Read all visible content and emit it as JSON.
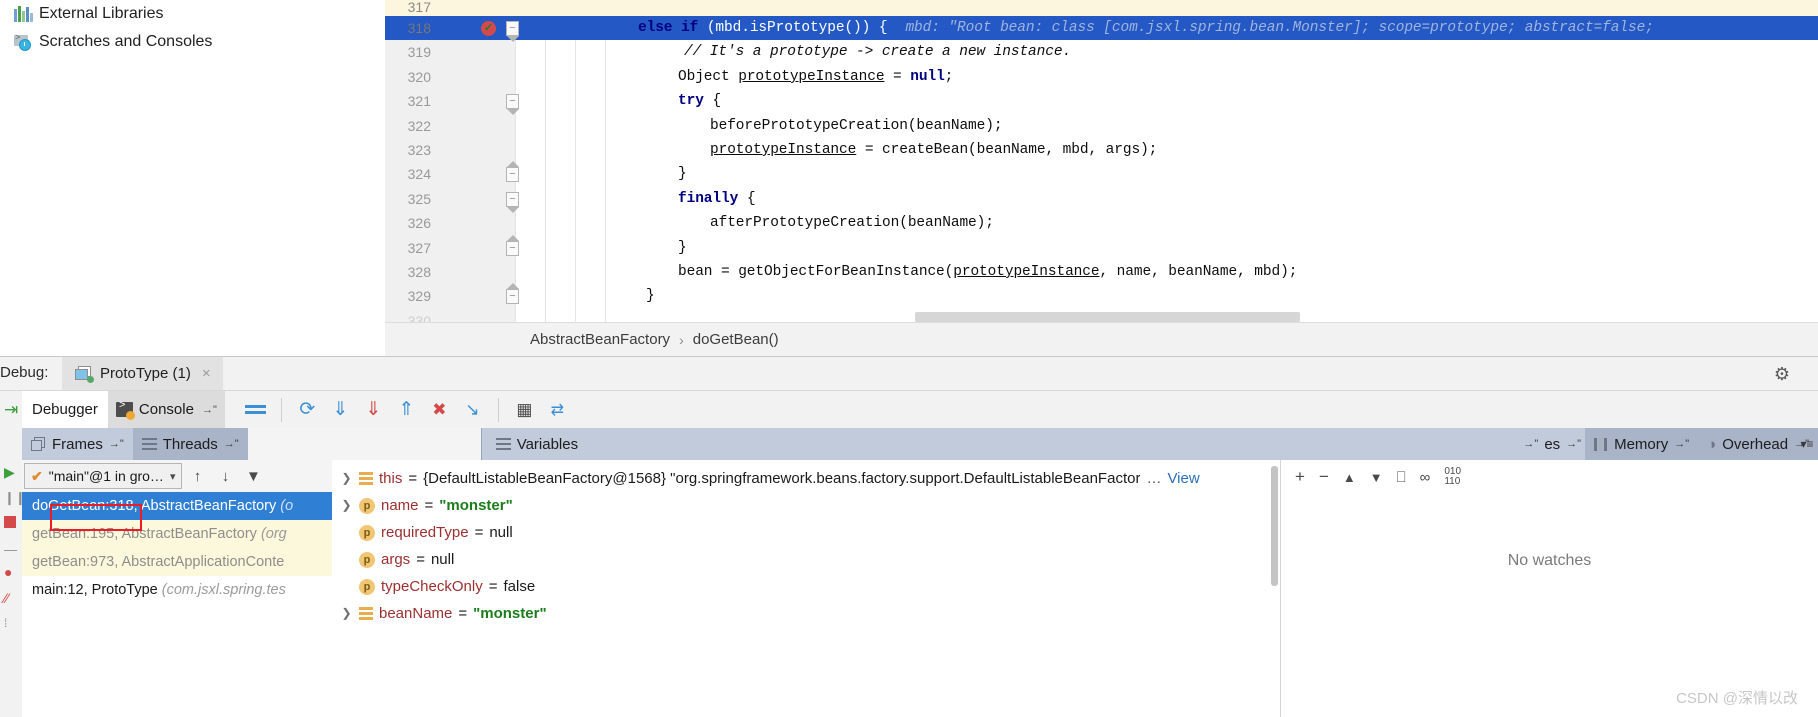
{
  "project_tree": {
    "items": [
      {
        "label": "External Libraries",
        "icon": "libraries-icon"
      },
      {
        "label": "Scratches and Consoles",
        "icon": "scratches-icon"
      }
    ]
  },
  "editor": {
    "lines": [
      {
        "num": "317",
        "code": "",
        "state": "above"
      },
      {
        "num": "318",
        "code": "else if (mbd.isPrototype()) {",
        "hint": "mbd: \"Root bean: class [com.jsxl.spring.bean.Monster]; scope=prototype; abstract=false;",
        "state": "highlighted",
        "breakpoint": true,
        "fold": "down"
      },
      {
        "num": "319",
        "code": "// It's a prototype -> create a new instance.",
        "state": "comment"
      },
      {
        "num": "320",
        "code": "Object prototypeInstance = null;",
        "state": "normal"
      },
      {
        "num": "321",
        "code": "try {",
        "state": "normal",
        "fold": "down"
      },
      {
        "num": "322",
        "code": "beforePrototypeCreation(beanName);",
        "state": "normal"
      },
      {
        "num": "323",
        "code": "prototypeInstance = createBean(beanName, mbd, args);",
        "state": "normal"
      },
      {
        "num": "324",
        "code": "}",
        "state": "normal",
        "fold": "up"
      },
      {
        "num": "325",
        "code": "finally {",
        "state": "normal",
        "fold": "down"
      },
      {
        "num": "326",
        "code": "afterPrototypeCreation(beanName);",
        "state": "normal"
      },
      {
        "num": "327",
        "code": "}",
        "state": "normal",
        "fold": "up"
      },
      {
        "num": "328",
        "code": "bean = getObjectForBeanInstance(prototypeInstance, name, beanName, mbd);",
        "state": "normal"
      },
      {
        "num": "329",
        "code": "}",
        "state": "normal",
        "fold": "up"
      },
      {
        "num": "330",
        "code": "",
        "state": "below"
      }
    ],
    "breadcrumb": {
      "class_name": "AbstractBeanFactory",
      "separator": "›",
      "method_name": "doGetBean()"
    }
  },
  "debug_window": {
    "title": "Debug:",
    "run_tab": {
      "label": "ProtoType (1)",
      "close": "×"
    },
    "settings_icon": "gear-icon",
    "tabs": [
      {
        "label": "Debugger",
        "active": true
      },
      {
        "label": "Console",
        "active": false
      }
    ],
    "toolbar_buttons": [
      {
        "name": "mute-breakpoints-button",
        "glyph": "≡"
      },
      {
        "name": "step-over-button",
        "glyph": "↷"
      },
      {
        "name": "step-into-button",
        "glyph": "↓"
      },
      {
        "name": "force-step-into-button",
        "glyph": "↓"
      },
      {
        "name": "step-out-button",
        "glyph": "↑"
      },
      {
        "name": "drop-frame-button",
        "glyph": "✕"
      },
      {
        "name": "run-to-cursor-button",
        "glyph": "↘"
      },
      {
        "name": "evaluate-expression-button",
        "glyph": "▦"
      },
      {
        "name": "settings-button",
        "glyph": "⇄"
      }
    ],
    "pane_tabs": [
      {
        "label": "Frames",
        "active": false,
        "icon": "frames-icon"
      },
      {
        "label": "Threads",
        "active": true,
        "icon": "threads-icon"
      },
      {
        "label": "Variables",
        "active": false,
        "icon": "variables-icon"
      }
    ],
    "right_pane_tabs": [
      {
        "label": "es",
        "icon": ""
      },
      {
        "label": "Memory",
        "icon": "memory-icon"
      },
      {
        "label": "Overhead",
        "icon": "overhead-icon"
      }
    ],
    "frames": {
      "thread_selector": "\"main\"@1 in gro…",
      "thread_state_icon": "check-icon",
      "buttons": [
        {
          "name": "frames-up-button",
          "glyph": "↑"
        },
        {
          "name": "frames-down-button",
          "glyph": "↓"
        },
        {
          "name": "frames-filter-button",
          "glyph": "▼"
        }
      ],
      "rows": [
        {
          "method": "doGetBean:318, AbstractBeanFactory",
          "pkg": "(o",
          "selected": true,
          "kind": "selected"
        },
        {
          "method": "getBean:195, AbstractBeanFactory",
          "pkg": "(org",
          "selected": false,
          "kind": "lib"
        },
        {
          "method": "getBean:973, AbstractApplicationConte",
          "pkg": "",
          "selected": false,
          "kind": "lib"
        },
        {
          "method": "main:12, ProtoType",
          "pkg": "(com.jsxl.spring.tes",
          "selected": false,
          "kind": "app"
        }
      ]
    },
    "variables": {
      "rows": [
        {
          "expandable": true,
          "icon": "object-icon",
          "name": "this",
          "value": "{DefaultListableBeanFactory@1568} \"org.springframework.beans.factory.support.DefaultListableBeanFactor",
          "value_type": "obj",
          "ellipsis": "…",
          "link": "View"
        },
        {
          "expandable": true,
          "icon": "parameter-icon",
          "name": "name",
          "value": "\"monster\"",
          "value_type": "str"
        },
        {
          "expandable": false,
          "icon": "parameter-icon",
          "name": "requiredType",
          "value": "null",
          "value_type": "null"
        },
        {
          "expandable": false,
          "icon": "parameter-icon",
          "name": "args",
          "value": "null",
          "value_type": "null"
        },
        {
          "expandable": false,
          "icon": "parameter-icon",
          "name": "typeCheckOnly",
          "value": "false",
          "value_type": "null"
        },
        {
          "expandable": true,
          "icon": "object-icon",
          "name": "beanName",
          "value": "\"monster\"",
          "value_type": "str"
        }
      ],
      "equals": "="
    },
    "watches": {
      "toolbar": [
        {
          "name": "add-watch-button",
          "glyph": "+"
        },
        {
          "name": "remove-watch-button",
          "glyph": "−"
        },
        {
          "name": "move-watch-up-button",
          "glyph": "▲"
        },
        {
          "name": "move-watch-down-button",
          "glyph": "▼"
        },
        {
          "name": "copy-watch-button",
          "glyph": "▤"
        },
        {
          "name": "inspect-button",
          "glyph": "∞"
        },
        {
          "name": "binary-view-button",
          "glyph": "010"
        }
      ],
      "empty_text": "No watches"
    },
    "watermark": "CSDN @深情以改"
  },
  "colors": {
    "highlight_blue": "#2458c4",
    "selection_blue": "#2f7fd4",
    "pane_header": "#c2cbdb",
    "breakpoint_red": "#d34a4a",
    "string_green": "#1a7d1a",
    "var_name_red": "#9c2f2f",
    "redbox": "#ed1c24"
  }
}
